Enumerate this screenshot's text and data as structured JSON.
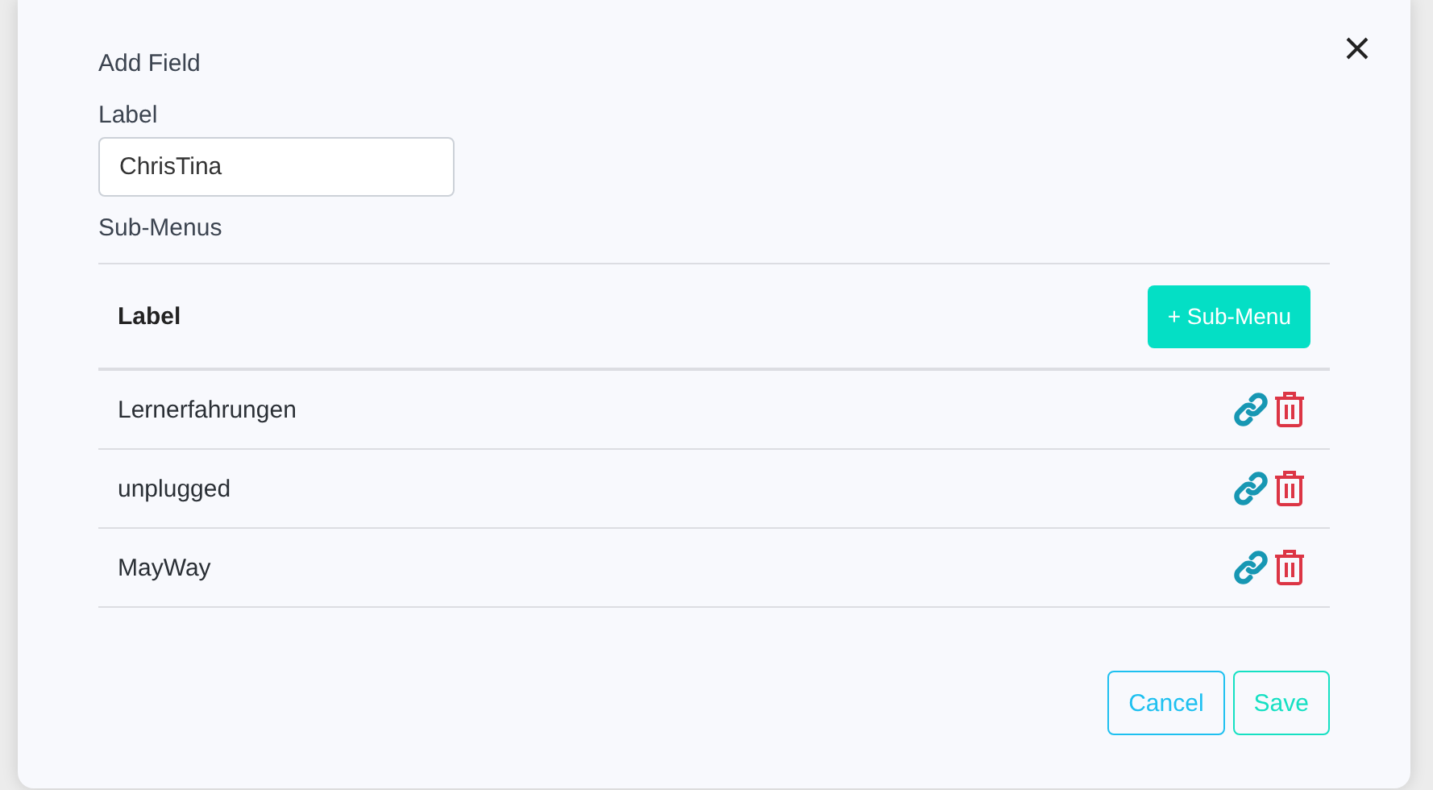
{
  "dialog": {
    "title": "Add Field"
  },
  "label_field": {
    "label": "Label",
    "value": "ChrisTina"
  },
  "submenus": {
    "heading": "Sub-Menus",
    "column": "Label",
    "add_button": "+ Sub-Menu",
    "rows": [
      {
        "label": "Lernerfahrungen"
      },
      {
        "label": "unplugged"
      },
      {
        "label": "MayWay"
      }
    ]
  },
  "buttons": [
    {
      "label": "Cancel",
      "kind": "secondary"
    },
    {
      "label": "Save",
      "kind": "primary"
    }
  ]
}
